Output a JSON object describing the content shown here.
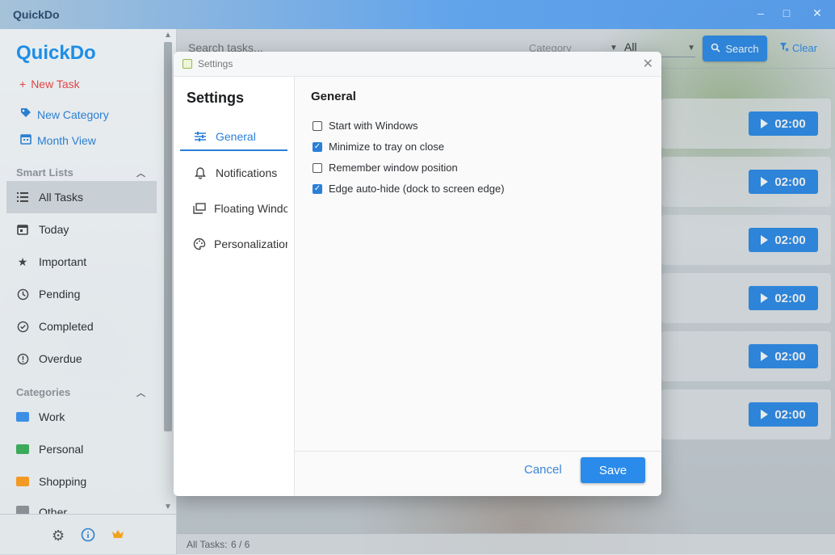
{
  "app": {
    "window_title": "QuickDo",
    "brand": "QuickDo"
  },
  "sidebar": {
    "new_task": "New Task",
    "new_category": "New Category",
    "month_view": "Month View",
    "smart_lists_title": "Smart Lists",
    "smart_lists": [
      {
        "label": "All Tasks",
        "icon": "list-icon"
      },
      {
        "label": "Today",
        "icon": "calendar-icon"
      },
      {
        "label": "Important",
        "icon": "star-icon"
      },
      {
        "label": "Pending",
        "icon": "clock-icon"
      },
      {
        "label": "Completed",
        "icon": "check-circle-icon"
      },
      {
        "label": "Overdue",
        "icon": "alert-circle-icon"
      }
    ],
    "categories_title": "Categories",
    "categories": [
      {
        "label": "Work",
        "color": "#3d8fe6"
      },
      {
        "label": "Personal",
        "color": "#3caa5a"
      },
      {
        "label": "Shopping",
        "color": "#f39a26"
      },
      {
        "label": "Other",
        "color": "#8a8f94"
      }
    ]
  },
  "toolbar": {
    "search_placeholder": "Search tasks...",
    "category_label": "Category",
    "category_value": "All",
    "search_button": "Search",
    "clear_button": "Clear"
  },
  "tasks": [
    {
      "timer": "02:00"
    },
    {
      "timer": "02:00"
    },
    {
      "timer": "02:00"
    },
    {
      "timer": "02:00"
    },
    {
      "timer": "02:00"
    },
    {
      "timer": "02:00"
    }
  ],
  "status": {
    "label": "All Tasks:",
    "count": "6 / 6"
  },
  "dialog": {
    "title": "Settings",
    "heading": "Settings",
    "nav": [
      {
        "label": "General",
        "icon": "sliders-icon"
      },
      {
        "label": "Notifications",
        "icon": "bell-icon"
      },
      {
        "label": "Floating Window",
        "icon": "window-icon"
      },
      {
        "label": "Personalization",
        "icon": "palette-icon"
      }
    ],
    "section_title": "General",
    "options": [
      {
        "label": "Start with Windows",
        "checked": false
      },
      {
        "label": "Minimize to tray on close",
        "checked": true
      },
      {
        "label": "Remember window position",
        "checked": false
      },
      {
        "label": "Edge auto-hide (dock to screen edge)",
        "checked": true
      }
    ],
    "cancel": "Cancel",
    "save": "Save"
  },
  "colors": {
    "accent": "#2a8bea",
    "danger": "#e04545"
  }
}
